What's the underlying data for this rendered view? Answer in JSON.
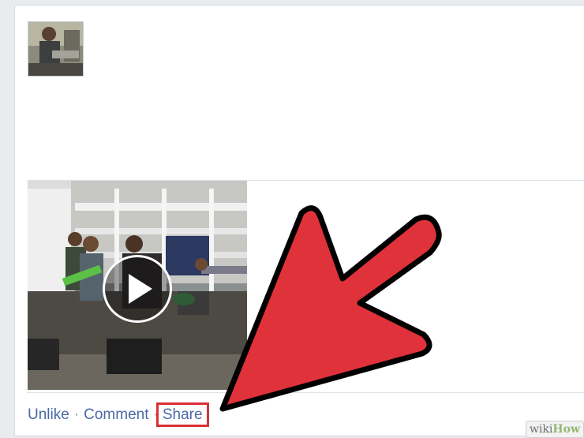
{
  "post": {
    "actions": {
      "unlike": "Unlike",
      "comment": "Comment",
      "share": "Share",
      "separator": "·"
    }
  },
  "watermark": {
    "brand_part1": "wiki",
    "brand_part2": "How"
  },
  "colors": {
    "link": "#4a6aa5",
    "highlight_box": "#d93036",
    "arrow_fill": "#e0323a",
    "arrow_outline": "#000000"
  }
}
